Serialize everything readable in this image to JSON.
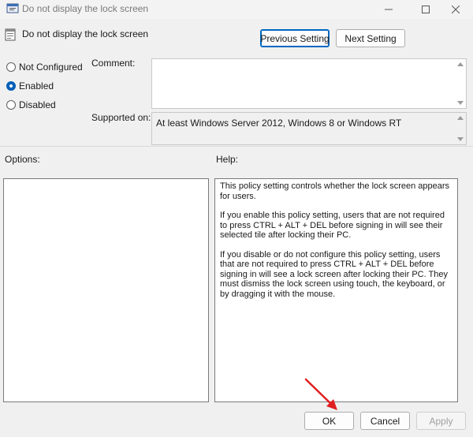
{
  "window": {
    "title": "Do not display the lock screen",
    "icon": "policy-icon",
    "controls": [
      "minimize-icon",
      "maximize-icon",
      "close-icon"
    ]
  },
  "header": {
    "policy_title": "Do not display the lock screen",
    "previous_setting": "Previous Setting",
    "next_setting": "Next Setting"
  },
  "state": {
    "options": [
      {
        "label": "Not Configured",
        "selected": false
      },
      {
        "label": "Enabled",
        "selected": true
      },
      {
        "label": "Disabled",
        "selected": false
      }
    ]
  },
  "comment": {
    "label": "Comment:",
    "value": ""
  },
  "supported": {
    "label": "Supported on:",
    "value": "At least Windows Server 2012, Windows 8 or Windows RT"
  },
  "options_label": "Options:",
  "help": {
    "label": "Help:",
    "paragraphs": [
      "This policy setting controls whether the lock screen appears for users.",
      "If you enable this policy setting, users that are not required to press CTRL + ALT + DEL before signing in will see their selected tile after locking their PC.",
      "If you disable or do not configure this policy setting, users that are not required to press CTRL + ALT + DEL before signing in will see a lock screen after locking their PC. They must dismiss the lock screen using touch, the keyboard, or by dragging it with the mouse."
    ]
  },
  "footer": {
    "ok": "OK",
    "cancel": "Cancel",
    "apply": "Apply",
    "apply_enabled": false
  },
  "colors": {
    "accent": "#005fb8",
    "annotation_arrow": "#e02020"
  }
}
